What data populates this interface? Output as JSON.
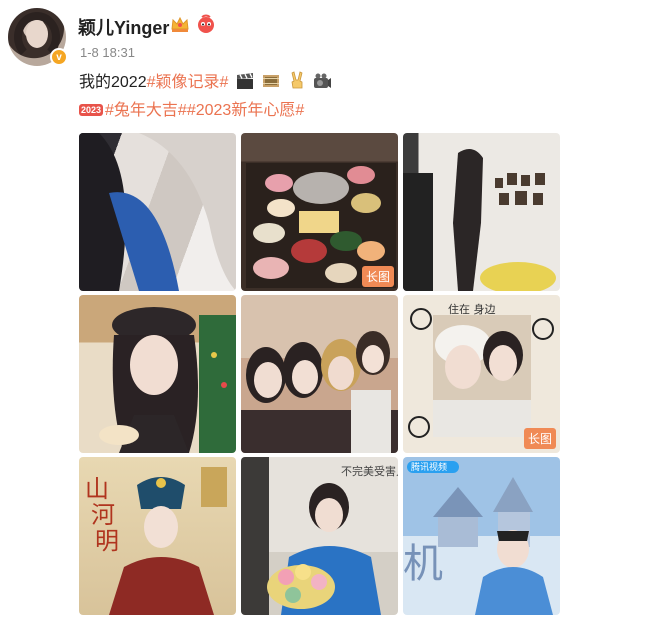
{
  "author": {
    "name": "颖儿Yinger",
    "meta": "1-8 18:31"
  },
  "content": {
    "line1_prefix": "我的2022",
    "line1_tag": "#颖像记录#",
    "line2_tags": "#兔年大吉##2023新年心愿#",
    "badge_2023": "2023"
  },
  "photos": {
    "long_image_label": "长图"
  },
  "colors": {
    "link": "#eb7350",
    "long_label_bg": "#f08a55"
  },
  "icons": [
    "verified-badge-icon",
    "crown-icon",
    "fan-badge-icon",
    "clapper-icon",
    "film-icon",
    "victory-hand-icon",
    "camera-icon"
  ]
}
